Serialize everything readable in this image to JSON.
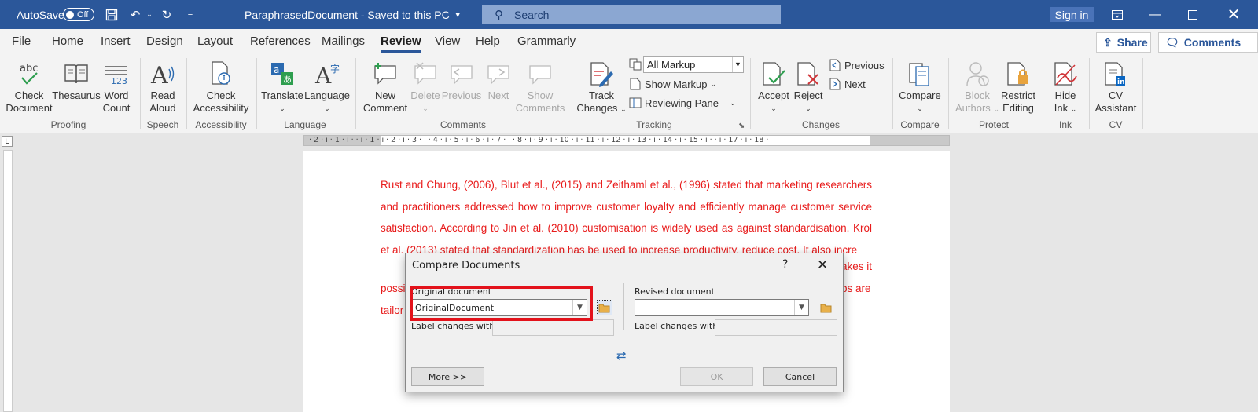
{
  "titlebar": {
    "autosave_label": "AutoSave",
    "autosave_state": "Off",
    "doc_title": "ParaphrasedDocument  -  Saved to this PC",
    "search_placeholder": "Search",
    "signin_label": "Sign in",
    "colors": {
      "bar": "#2b579a"
    }
  },
  "tabs": [
    "File",
    "Home",
    "Insert",
    "Design",
    "Layout",
    "References",
    "Mailings",
    "Review",
    "View",
    "Help",
    "Grammarly"
  ],
  "active_tab": "Review",
  "share_label": "Share",
  "comments_label": "Comments",
  "ribbon": {
    "proofing": {
      "group": "Proofing",
      "check_document": [
        "Check",
        "Document"
      ],
      "thesaurus": "Thesaurus",
      "word_count": [
        "Word",
        "Count"
      ]
    },
    "speech": {
      "group": "Speech",
      "read_aloud": [
        "Read",
        "Aloud"
      ]
    },
    "accessibility": {
      "group": "Accessibility",
      "check_accessibility": [
        "Check",
        "Accessibility"
      ]
    },
    "language": {
      "group": "Language",
      "translate": "Translate",
      "language": "Language"
    },
    "comments": {
      "group": "Comments",
      "new_comment": [
        "New",
        "Comment"
      ],
      "delete": "Delete",
      "previous": "Previous",
      "next": "Next",
      "show_comments": [
        "Show",
        "Comments"
      ]
    },
    "tracking": {
      "group": "Tracking",
      "track_changes": [
        "Track",
        "Changes"
      ],
      "markup_value": "All Markup",
      "show_markup": "Show Markup",
      "reviewing_pane": "Reviewing Pane"
    },
    "changes": {
      "group": "Changes",
      "accept": "Accept",
      "reject": "Reject",
      "previous": "Previous",
      "next": "Next"
    },
    "compare": {
      "group": "Compare",
      "compare": "Compare"
    },
    "protect": {
      "group": "Protect",
      "block_authors": [
        "Block",
        "Authors"
      ],
      "restrict_editing": [
        "Restrict",
        "Editing"
      ]
    },
    "ink": {
      "group": "Ink",
      "hide_ink": [
        "Hide",
        "Ink"
      ]
    },
    "cv": {
      "group": "CV",
      "cv_assistant": [
        "CV",
        "Assistant"
      ]
    }
  },
  "ruler_text": "· 2 · ı · 1 · ı ·   · ı · 1 · ı · 2 · ı · 3 · ı · 4 · ı · 5 · ı · 6 · ı · 7 · ı · 8 · ı · 9 · ı · 10 · ı · 11 · ı · 12 · ı · 13 · ı · 14 · ı · 15 · ı ·   · ı · 17 · ı · 18 ·",
  "document": {
    "paragraph": "Rust and Chung, (2006), Blut et al., (2015) and Zeithaml et al., (1996) stated that marketing researchers and practitioners addressed how to improve customer loyalty and efficiently manage customer service satisfaction. According to Jin et al. (2010) customisation is widely used as against standardisation. Krol et al. (2013) stated that standardization has be used to increase productivity, reduce cost. It also incre",
    "line5_tail": "akes it",
    "line6_head": "possi",
    "line6_tail": "ps are",
    "line7_head": "tailor",
    "text_color": "#e81b1b"
  },
  "dialog": {
    "title": "Compare Documents",
    "help": "?",
    "original_label": "Original document",
    "original_value": "OriginalDocument",
    "original_label_changes": "Label changes with",
    "revised_label": "Revised document",
    "revised_value": "",
    "revised_label_changes": "Label changes with",
    "more_button": "More >>",
    "ok_button": "OK",
    "cancel_button": "Cancel",
    "highlight_color": "#e3121b"
  }
}
